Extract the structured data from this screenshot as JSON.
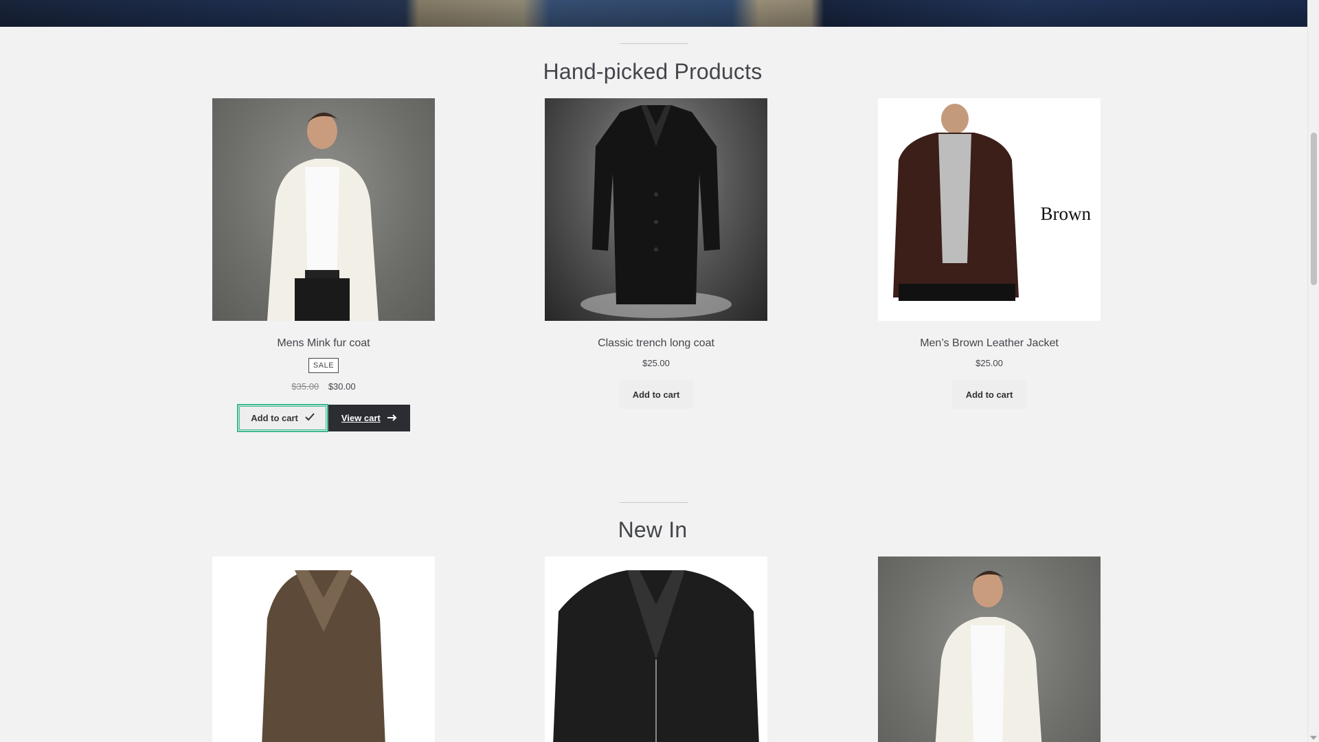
{
  "sections": {
    "handpicked_title": "Hand-picked Products",
    "newin_title": "New In"
  },
  "handpicked": [
    {
      "name": "Mens Mink fur coat",
      "badge": "SALE",
      "old_price": "$35.00",
      "price": "$30.00",
      "added_label": "Add to cart",
      "view_cart_label": "View cart"
    },
    {
      "name": "Classic trench long coat",
      "price": "$25.00",
      "button_label": "Add to cart"
    },
    {
      "name": "Men’s Brown Leather Jacket",
      "price": "$25.00",
      "button_label": "Add to cart",
      "image_caption": "Brown"
    }
  ],
  "colors": {
    "background": "#f2f2f2",
    "added_border": "#3bb88f",
    "view_cart_bg": "#2c2d33",
    "button_bg": "#eeeeee"
  },
  "icons": {
    "added": "check-icon",
    "view_cart": "arrow-right-icon"
  }
}
